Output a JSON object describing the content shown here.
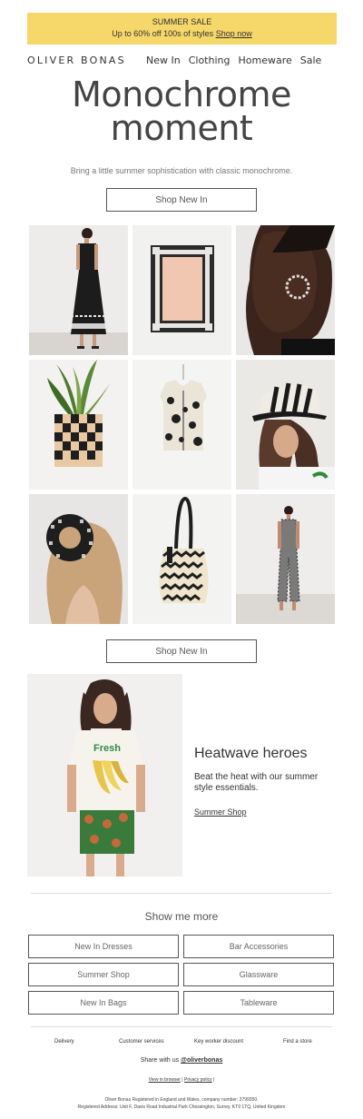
{
  "banner": {
    "title": "SUMMER SALE",
    "text": "Up to 60% off 100s of styles",
    "link": "Shop now",
    "color": "#f5d76a"
  },
  "nav": {
    "brand": "OLIVER BONAS",
    "items": [
      "New In",
      "Clothing",
      "Homeware",
      "Sale"
    ]
  },
  "hero": {
    "headline_line1": "Monochrome",
    "headline_line2": "moment",
    "subtitle": "Bring a little summer sophistication with classic monochrome.",
    "button": "Shop New In"
  },
  "products": [
    "black-dress",
    "photo-frame",
    "statement-earring",
    "checkered-planter",
    "printed-vest",
    "striped-cap",
    "gingham-scrunchie",
    "zigzag-tote",
    "gingham-jumpsuit"
  ],
  "shop_button_2": "Shop New In",
  "feature": {
    "title": "Heatwave heroes",
    "text": "Beat the heat with our summer style essentials.",
    "link": "Summer Shop",
    "tee_text": "Fresh"
  },
  "more": {
    "title": "Show me more",
    "buttons": [
      "New In Dresses",
      "Bar Accessories",
      "Summer Shop",
      "Glassware",
      "New In Bags",
      "Tableware"
    ]
  },
  "footer": {
    "links": [
      "Delivery",
      "Customer services",
      "Key worker discount",
      "Find a store"
    ],
    "share_text": "Share with us",
    "share_handle": "@oliverbonas",
    "view_in_browser": "View in browser",
    "separator": "|",
    "privacy": "Privacy policy",
    "legal_line1": "Oliver Bonas Registered in England and Wales, company number: 3799350.",
    "legal_line2": "Registered Address: Unit F, Davis Road Industrial Park Chessington, Surrey, KT9 1TQ, United Kingdom"
  }
}
